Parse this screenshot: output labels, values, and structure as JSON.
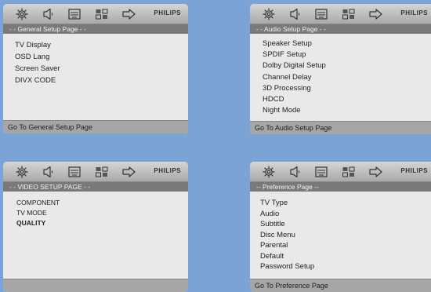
{
  "background": "#7ba3d6",
  "brand": "PHILIPS",
  "toolbar_icons": [
    "gear-icon",
    "speaker-icon",
    "video-icon",
    "preference-icon",
    "exit-icon"
  ],
  "panels": {
    "general": {
      "title": "- -  General  Setup  Page  - -",
      "items": [
        "TV Display",
        "OSD Lang",
        "Screen Saver",
        "DIVX CODE"
      ],
      "footer": "Go To General Setup Page"
    },
    "audio": {
      "title": "- -  Audio  Setup  Page  - -",
      "items": [
        "Speaker Setup",
        "SPDIF Setup",
        "Dolby Digital Setup",
        "Channel Delay",
        "3D Processing",
        "HDCD",
        "Night Mode"
      ],
      "footer": "Go To Audio Setup Page"
    },
    "video": {
      "title": "- - VIDEO SETUP PAGE - -",
      "items": [
        "COMPONENT",
        "TV MODE",
        "QUALITY"
      ],
      "footer": ""
    },
    "preference": {
      "title": "-- Preference Page --",
      "items": [
        "TV Type",
        "Audio",
        "Subtitle",
        "Disc Menu",
        "Parental",
        "Default",
        "Password Setup"
      ],
      "footer": "Go To Preference Page"
    }
  }
}
